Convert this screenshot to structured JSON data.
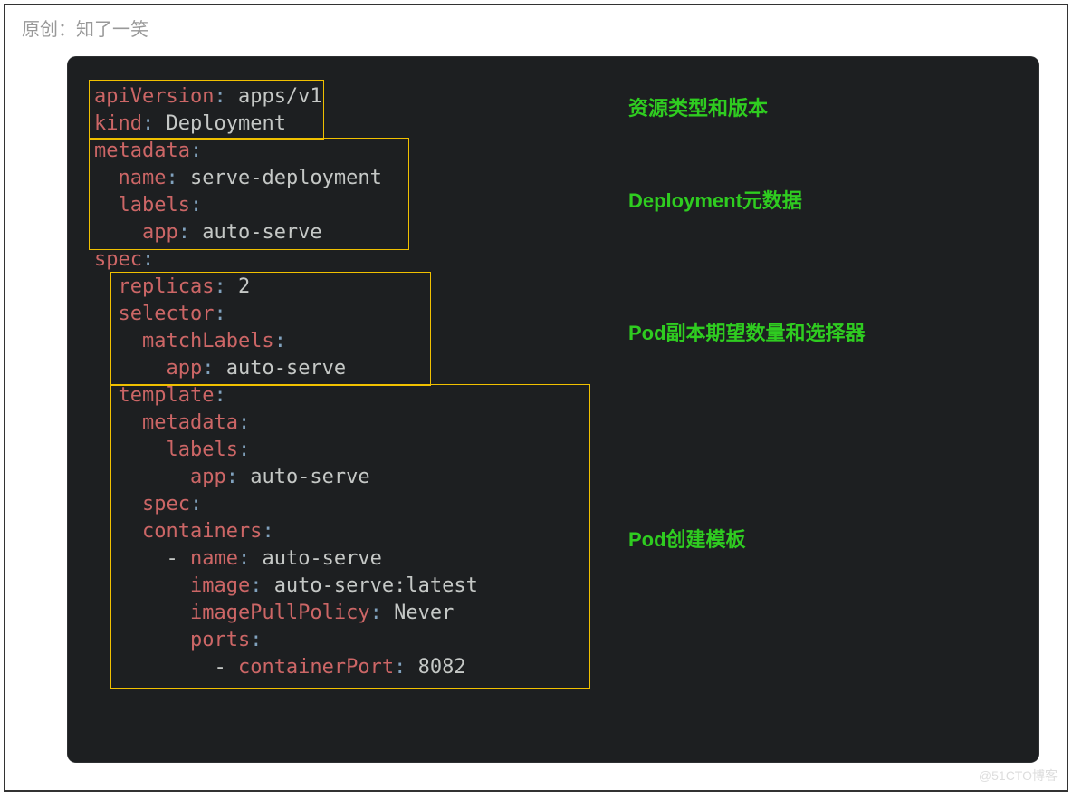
{
  "header": {
    "attribution": "原创：知了一笑"
  },
  "labels": {
    "sec1": "资源类型和版本",
    "sec2": "Deployment元数据",
    "sec3": "Pod副本期望数量和选择器",
    "sec4": "Pod创建模板"
  },
  "code": {
    "l1k": "apiVersion",
    "l1c": ": ",
    "l1v": "apps/v1",
    "l2k": "kind",
    "l2c": ": ",
    "l2v": "Deployment",
    "l3k": "metadata",
    "l3c": ":",
    "l4k": "  name",
    "l4c": ": ",
    "l4v": "serve-deployment",
    "l5k": "  labels",
    "l5c": ":",
    "l6k": "    app",
    "l6c": ": ",
    "l6v": "auto-serve",
    "l7k": "spec",
    "l7c": ":",
    "l8k": "  replicas",
    "l8c": ": ",
    "l8v": "2",
    "l9k": "  selector",
    "l9c": ":",
    "l10k": "    matchLabels",
    "l10c": ":",
    "l11k": "      app",
    "l11c": ": ",
    "l11v": "auto-serve",
    "l12k": "  template",
    "l12c": ":",
    "l13k": "    metadata",
    "l13c": ":",
    "l14k": "      labels",
    "l14c": ":",
    "l15k": "        app",
    "l15c": ": ",
    "l15v": "auto-serve",
    "l16k": "    spec",
    "l16c": ":",
    "l17k": "    containers",
    "l17c": ":",
    "l18p": "      - ",
    "l18k": "name",
    "l18c": ": ",
    "l18v": "auto-serve",
    "l19k": "        image",
    "l19c": ": ",
    "l19v": "auto-serve:latest",
    "l20k": "        imagePullPolicy",
    "l20c": ": ",
    "l20v": "Never",
    "l21k": "        ports",
    "l21c": ":",
    "l22p": "          - ",
    "l22k": "containerPort",
    "l22c": ": ",
    "l22v": "8082"
  },
  "watermark": "@51CTO博客"
}
